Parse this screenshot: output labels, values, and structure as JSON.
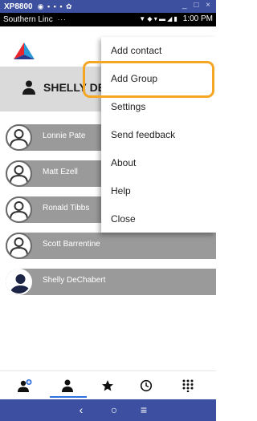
{
  "emulator": {
    "title": "XP8800",
    "status_glyphs": "◉ ▪ ▪ ▪ ✿",
    "window_controls": "_ □ ×"
  },
  "status_bar": {
    "carrier": "Southern Linc",
    "dots": "···",
    "icons": "▼ ◆ ▾ ▬ ◢ ▮",
    "time": "1:00 PM"
  },
  "header": {
    "logo": "red-blue-triangle-logo",
    "user_name": "SHELLY DE",
    "user_icon": "person-icon"
  },
  "contacts": [
    {
      "name": "Lonnie Pate",
      "avatar": "outline"
    },
    {
      "name": "Matt Ezell",
      "avatar": "outline"
    },
    {
      "name": "Ronald Tibbs",
      "avatar": "outline"
    },
    {
      "name": "Scott Barrentine",
      "avatar": "outline"
    },
    {
      "name": "Shelly DeChabert",
      "avatar": "filled"
    }
  ],
  "menu": {
    "items": [
      "Add contact",
      "Add Group",
      "Settings",
      "Send feedback",
      "About",
      "Help",
      "Close"
    ],
    "highlighted": "Add Group"
  },
  "tabs": [
    {
      "icon": "group-add-icon",
      "badge": "+"
    },
    {
      "icon": "person-icon",
      "active": true
    },
    {
      "icon": "star-icon"
    },
    {
      "icon": "clock-icon"
    },
    {
      "icon": "dialpad-icon"
    }
  ],
  "nav": {
    "back": "‹",
    "home": "○",
    "menu": "≡"
  },
  "colors": {
    "emulator_bar": "#3d4f9f",
    "nav_bar": "#3c4fa0",
    "contact_row": "#9a9a9a",
    "user_bar": "#dadada",
    "highlight": "#f5a623",
    "active_tab": "#2f6fe0"
  }
}
